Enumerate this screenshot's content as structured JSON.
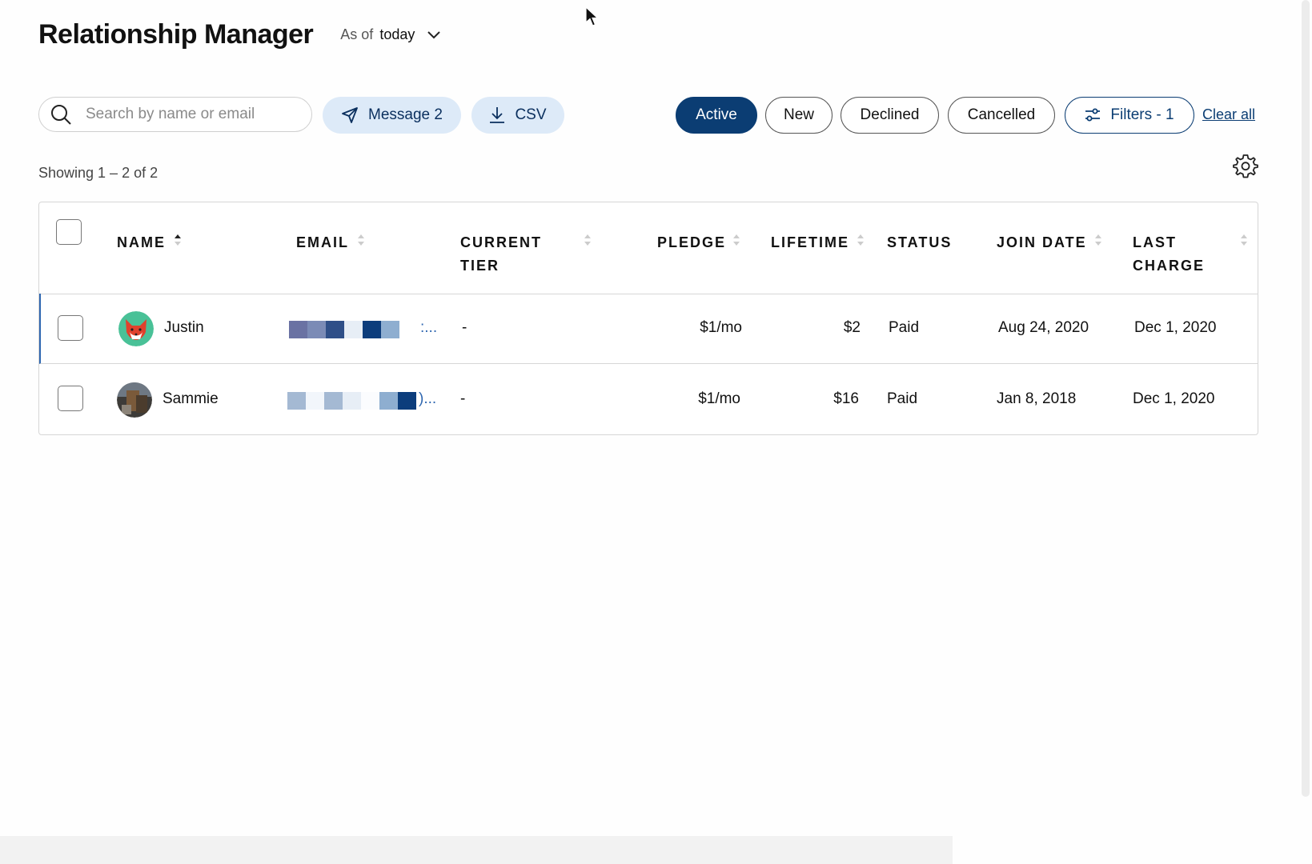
{
  "header": {
    "title": "Relationship Manager",
    "as_of_prefix": "As of",
    "as_of_value": "today"
  },
  "toolbar": {
    "search_placeholder": "Search by name or email",
    "search_value": "",
    "message_label": "Message 2",
    "csv_label": "CSV",
    "filter_pills": [
      "Active",
      "New",
      "Declined",
      "Cancelled"
    ],
    "active_filter": "Active",
    "filters_label": "Filters - 1",
    "clear_all_label": "Clear all"
  },
  "results": {
    "showing_text": "Showing 1 – 2 of 2"
  },
  "table": {
    "columns": [
      {
        "line1": "NAME",
        "line2": ""
      },
      {
        "line1": "EMAIL",
        "line2": ""
      },
      {
        "line1": "CURRENT",
        "line2": "TIER"
      },
      {
        "line1": "PLEDGE",
        "line2": ""
      },
      {
        "line1": "LIFETIME",
        "line2": ""
      },
      {
        "line1": "STATUS",
        "line2": ""
      },
      {
        "line1": "JOIN DATE",
        "line2": ""
      },
      {
        "line1": "LAST",
        "line2": "CHARGE"
      }
    ],
    "rows": [
      {
        "name": "Justin",
        "email_suffix": ":...",
        "tier": "-",
        "pledge": "$1/mo",
        "lifetime": "$2",
        "status": "Paid",
        "join_date": "Aug 24, 2020",
        "last_charge": "Dec 1, 2020"
      },
      {
        "name": "Sammie",
        "email_suffix": ")...",
        "tier": "-",
        "pledge": "$1/mo",
        "lifetime": "$16",
        "status": "Paid",
        "join_date": "Jan 8, 2018",
        "last_charge": "Dec 1, 2020"
      }
    ]
  },
  "colors": {
    "accent": "#0b3d73",
    "pill_light_bg": "#ddeaf8",
    "row_highlight": "#2f67b0"
  },
  "icons": {
    "search": "search-icon",
    "message": "send-icon",
    "csv": "download-icon",
    "filters": "sliders-icon",
    "settings": "gear-icon",
    "as_of": "chevron-down-icon"
  }
}
